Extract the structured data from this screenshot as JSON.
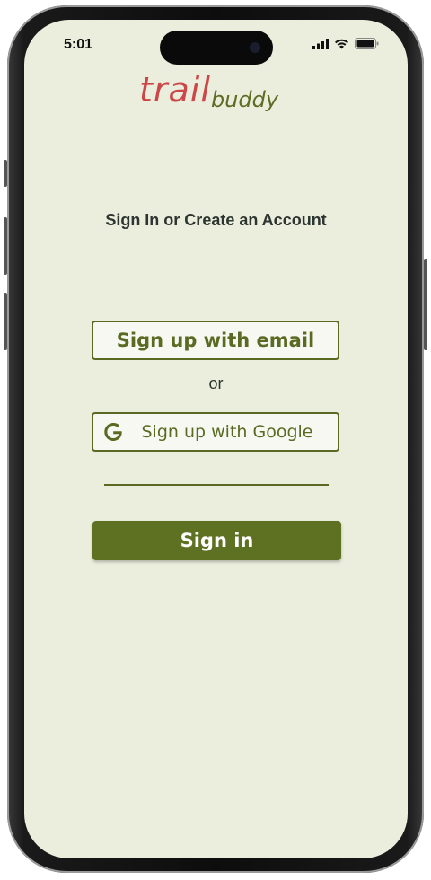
{
  "status_bar": {
    "time": "5:01",
    "icons": [
      "signal-icon",
      "wifi-icon",
      "battery-icon"
    ]
  },
  "logo": {
    "primary": "trail",
    "secondary": "buddy"
  },
  "heading": "Sign In or Create an Account",
  "actions": {
    "email_signup_label": "Sign up with email",
    "separator": "or",
    "google_signup_label": "Sign up with Google",
    "signin_label": "Sign in"
  },
  "colors": {
    "background": "#ebeddd",
    "brand_green": "#5e7122",
    "brand_red": "#cc4747"
  }
}
